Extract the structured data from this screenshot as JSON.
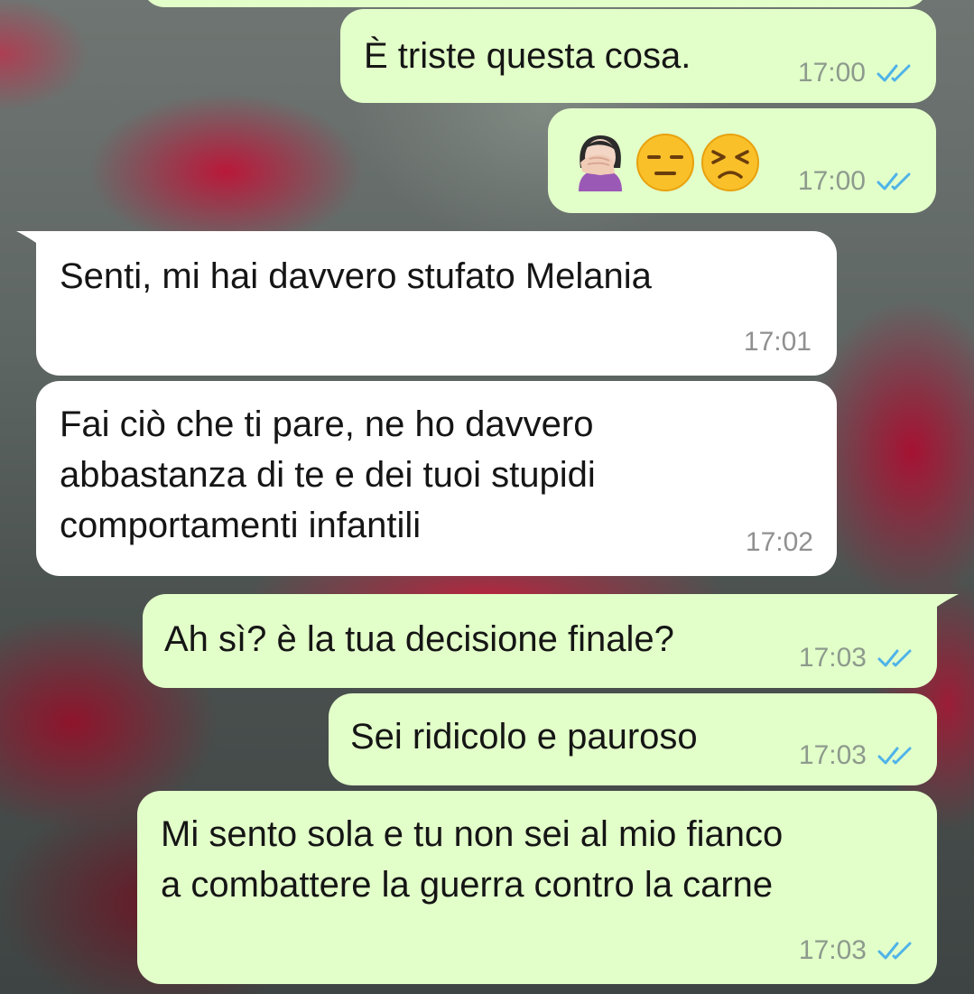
{
  "conversation": {
    "messages": [
      {
        "id": "m1",
        "text": "È triste questa cosa.",
        "time": "17:00",
        "read": true
      },
      {
        "id": "m2",
        "emojis": [
          "woman-facepalming-icon",
          "expressionless-face-icon",
          "persevering-face-icon"
        ],
        "time": "17:00",
        "read": true
      },
      {
        "id": "m3",
        "text": "Senti, mi hai davvero stufato Melania",
        "time": "17:01"
      },
      {
        "id": "m4",
        "text": "Fai ciò che ti pare, ne ho davvero\nabbastanza di te e dei tuoi stupidi\ncomportamenti infantili",
        "time": "17:02"
      },
      {
        "id": "m5",
        "text": "Ah sì? è la tua decisione finale?",
        "time": "17:03",
        "read": true
      },
      {
        "id": "m6",
        "text": "Sei ridicolo e pauroso",
        "time": "17:03",
        "read": true
      },
      {
        "id": "m7",
        "text": "Mi sento sola e tu non sei al mio fianco\na combattere la guerra contro la carne",
        "time": "17:03",
        "read": true
      }
    ]
  },
  "colors": {
    "outgoing_bubble": "#e2ffc9",
    "incoming_bubble": "#ffffff",
    "read_ticks": "#4fb3e8"
  }
}
